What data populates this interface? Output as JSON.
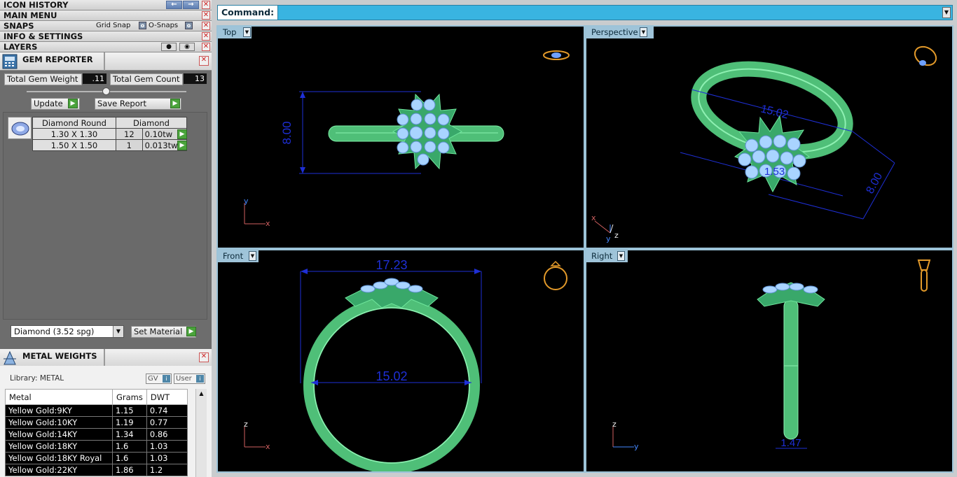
{
  "left_panel": {
    "rows": {
      "icon_history": "ICON HISTORY",
      "main_menu": "MAIN MENU",
      "snaps": "SNAPS",
      "grid_snap": "Grid Snap",
      "o_snaps": "O-Snaps",
      "info_settings": "INFO & SETTINGS",
      "layers": "LAYERS"
    },
    "gem_reporter": {
      "title": "GEM REPORTER",
      "total_weight_label": "Total Gem Weight",
      "total_weight_value": ".11",
      "total_count_label": "Total Gem Count",
      "total_count_value": "13",
      "update_label": "Update",
      "save_report_label": "Save Report",
      "table_headers": [
        "Diamond Round",
        "Diamond"
      ],
      "rows": [
        {
          "size": "1.30 X 1.30",
          "count": "12",
          "tw": "0.10tw"
        },
        {
          "size": "1.50 X 1.50",
          "count": "1",
          "tw": "0.013tw"
        }
      ],
      "material_select": "Diamond      (3.52 spg)",
      "set_material_label": "Set Material"
    },
    "metal_weights": {
      "title": "METAL WEIGHTS",
      "library_label": "Library: METAL",
      "gv_label": "GV",
      "user_label": "User",
      "headers": [
        "Metal",
        "Grams",
        "DWT"
      ],
      "rows": [
        {
          "metal": "Yellow Gold:9KY",
          "grams": "1.15",
          "dwt": "0.74"
        },
        {
          "metal": "Yellow Gold:10KY",
          "grams": "1.19",
          "dwt": "0.77"
        },
        {
          "metal": "Yellow Gold:14KY",
          "grams": "1.34",
          "dwt": "0.86"
        },
        {
          "metal": "Yellow Gold:18KY",
          "grams": "1.6",
          "dwt": "1.03"
        },
        {
          "metal": "Yellow Gold:18KY Royal",
          "grams": "1.6",
          "dwt": "1.03"
        },
        {
          "metal": "Yellow Gold:22KY",
          "grams": "1.86",
          "dwt": "1.2"
        }
      ]
    }
  },
  "command_bar": {
    "label": "Command:"
  },
  "viewports": {
    "top": {
      "label": "Top",
      "dim_height": "8.00",
      "axis_a": "y",
      "axis_b": "x"
    },
    "perspective": {
      "label": "Perspective",
      "dim_length": "15.02",
      "dim_height": "8.00",
      "dim_center": "1.53",
      "axis_a": "x",
      "axis_b": "y",
      "axis_c": "z"
    },
    "front": {
      "label": "Front",
      "dim_outer": "17.23",
      "dim_inner": "15.02",
      "axis_a": "z",
      "axis_b": "x"
    },
    "right": {
      "label": "Right",
      "dim_width": "1.47",
      "axis_a": "z",
      "axis_b": "y"
    }
  },
  "colors": {
    "ring_green": "#5fd38a",
    "gem_blue": "#a9d4ff",
    "dimension_blue": "#1e2fd6",
    "command_bar": "#39b4e1",
    "viewport_label": "#9fc4d9"
  }
}
